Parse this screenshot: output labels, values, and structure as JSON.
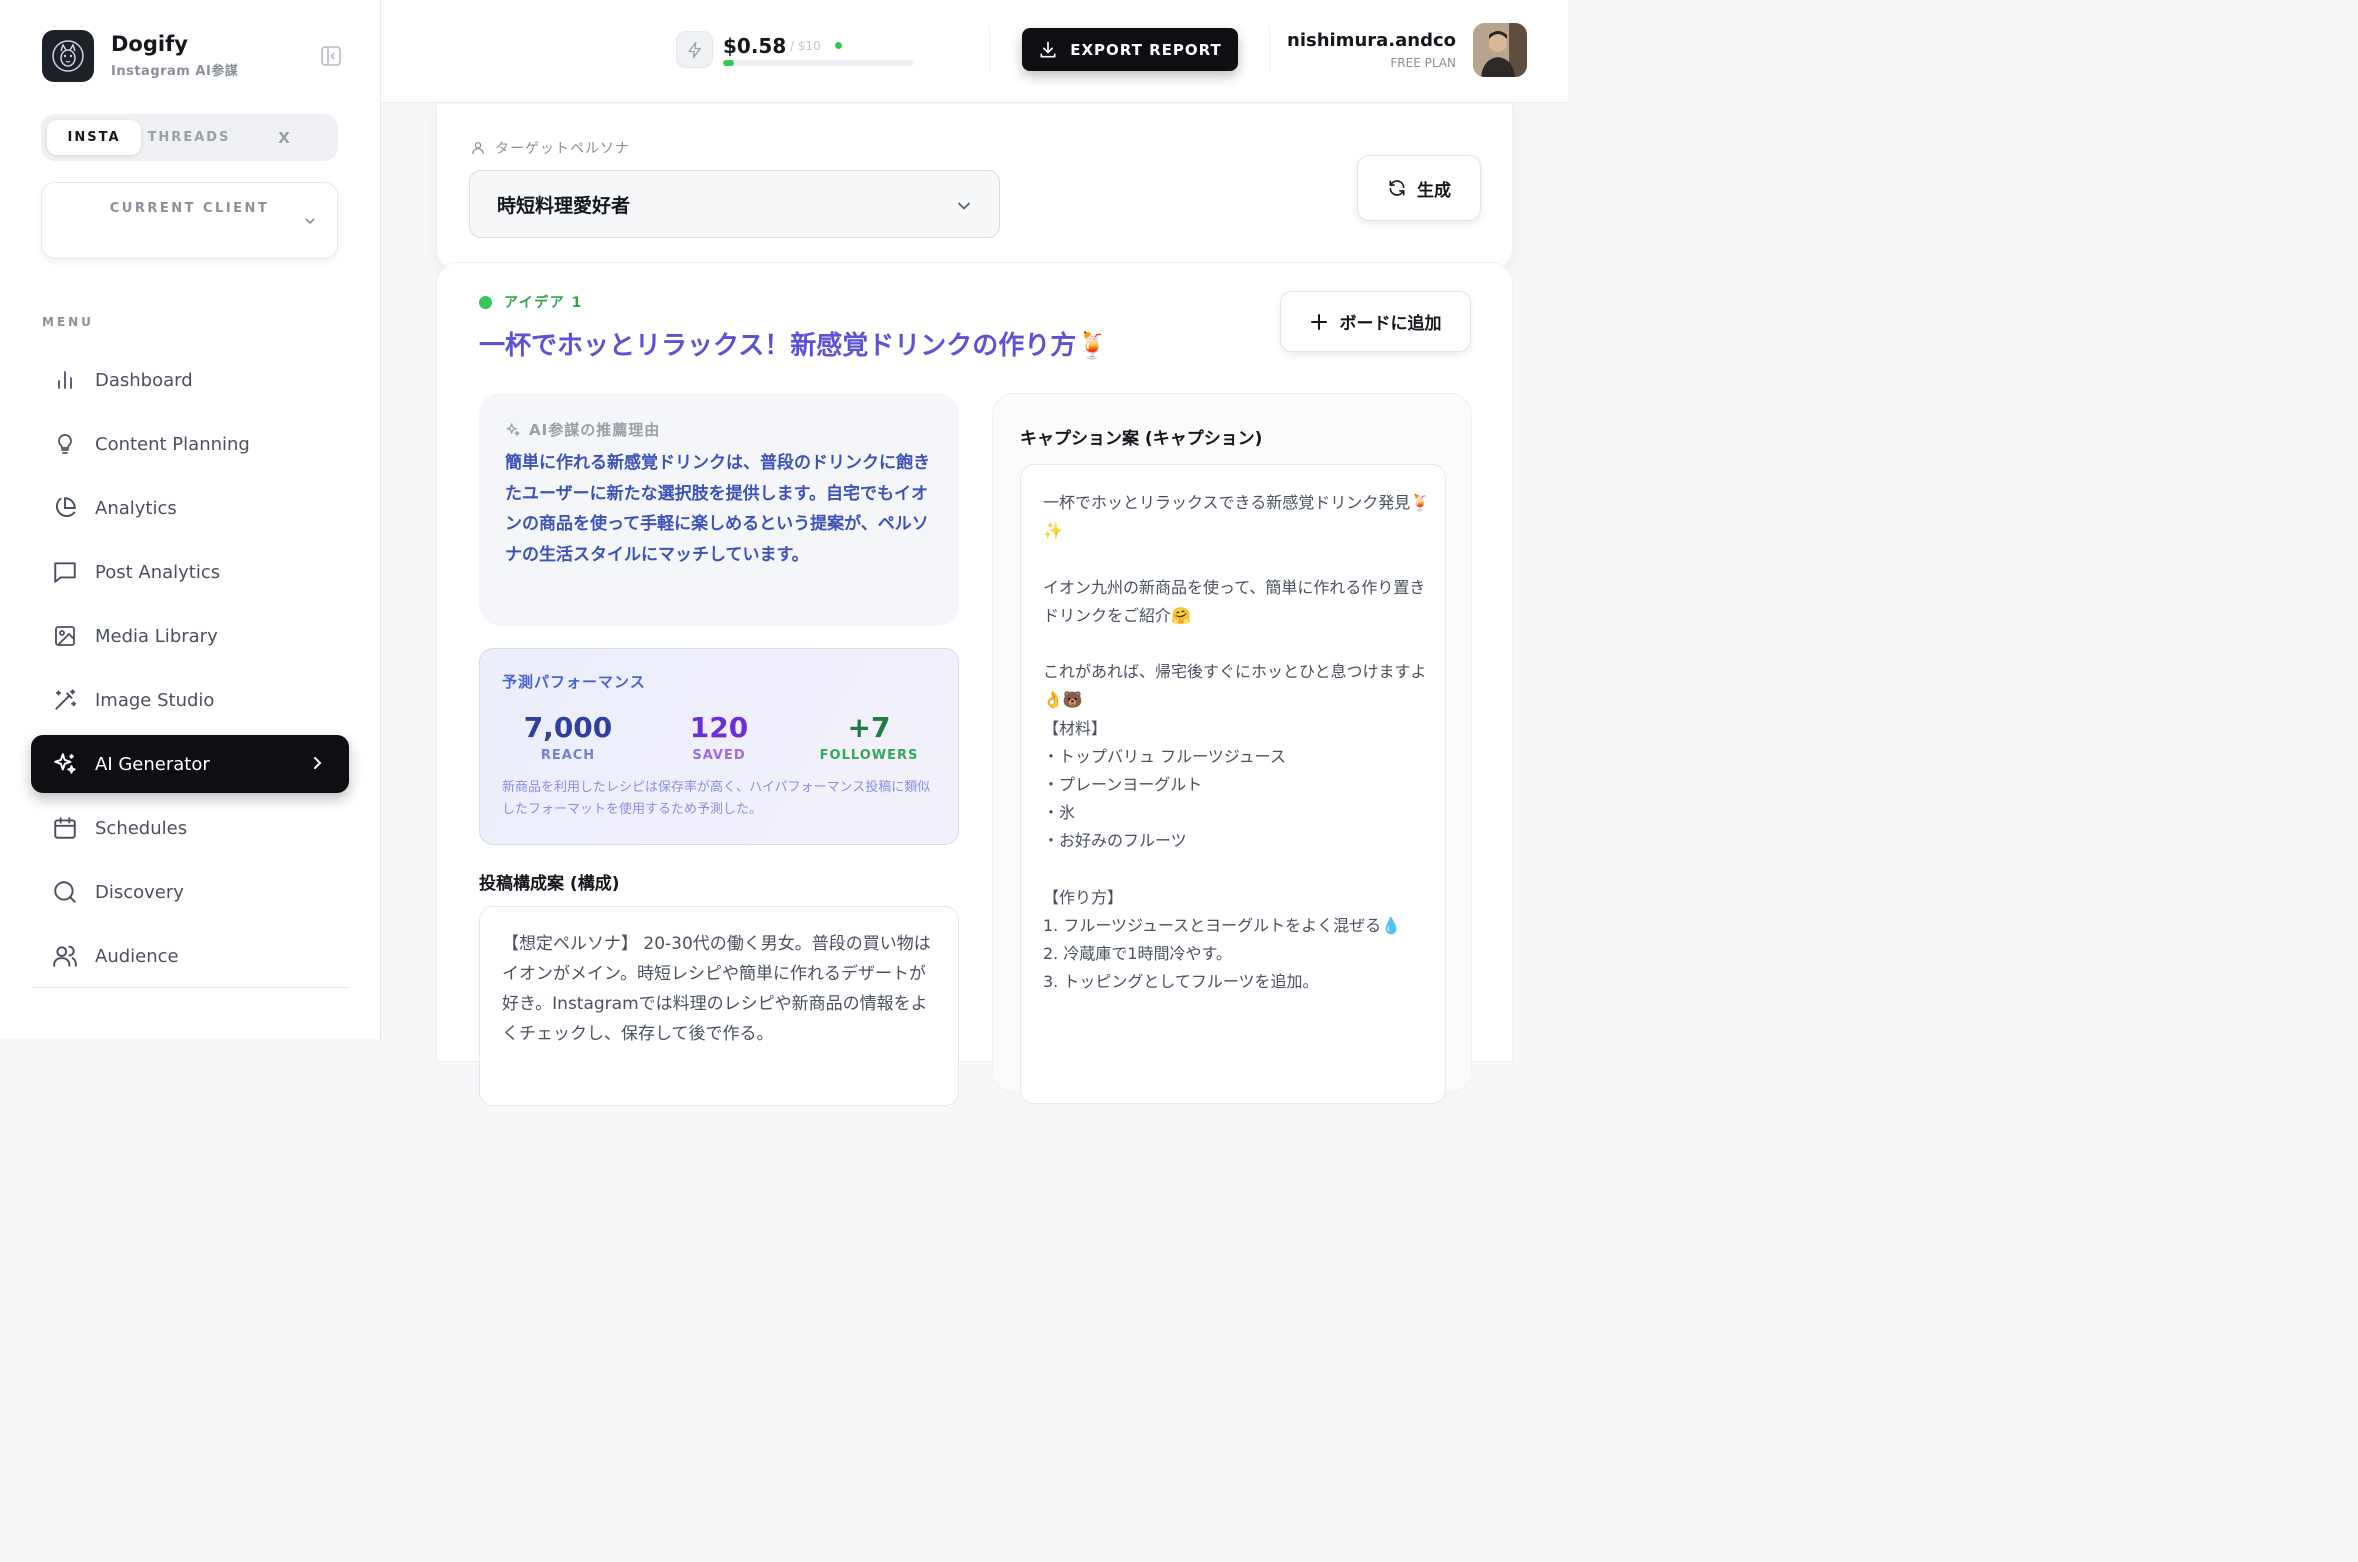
{
  "brand": {
    "name": "Dogify",
    "subtitle": "Instagram AI参謀"
  },
  "platform_tabs": [
    "INSTA",
    "THREADS",
    "X"
  ],
  "client": {
    "label": "CURRENT CLIENT"
  },
  "menu": {
    "label": "MENU",
    "items": [
      {
        "label": "Dashboard",
        "icon": "bar-chart-icon"
      },
      {
        "label": "Content Planning",
        "icon": "lightbulb-icon"
      },
      {
        "label": "Analytics",
        "icon": "pie-chart-icon"
      },
      {
        "label": "Post Analytics",
        "icon": "message-square-icon"
      },
      {
        "label": "Media Library",
        "icon": "image-icon"
      },
      {
        "label": "Image Studio",
        "icon": "wand-icon"
      },
      {
        "label": "AI Generator",
        "icon": "sparkles-icon",
        "active": true
      },
      {
        "label": "Schedules",
        "icon": "calendar-icon"
      },
      {
        "label": "Discovery",
        "icon": "search-icon"
      },
      {
        "label": "Audience",
        "icon": "users-icon"
      }
    ]
  },
  "header": {
    "cost_value": "$0.58",
    "cost_limit": "/ $10",
    "cost_usage_fraction": 0.058,
    "export_label": "EXPORT REPORT",
    "user_name": "nishimura.andco",
    "user_plan": "FREE PLAN"
  },
  "persona": {
    "label": "ターゲットペルソナ",
    "selected": "時短料理愛好者",
    "generate_label": "生成"
  },
  "idea": {
    "tag": "アイデア 1",
    "title": "一杯でホッとリラックス！新感覚ドリンクの作り方🍹",
    "add_board_label": "ボードに追加",
    "reason_label": "AI参謀の推薦理由",
    "reason_text": "簡単に作れる新感覚ドリンクは、普段のドリンクに飽きたユーザーに新たな選択肢を提供します。自宅でもイオンの商品を使って手軽に楽しめるという提案が、ペルソナの生活スタイルにマッチしています。",
    "performance": {
      "label": "予測パフォーマンス",
      "reach": {
        "value": "7,000",
        "label": "REACH"
      },
      "saved": {
        "value": "120",
        "label": "SAVED"
      },
      "followers": {
        "value": "+7",
        "label": "FOLLOWERS"
      },
      "note": "新商品を利用したレシピは保存率が高く、ハイパフォーマンス投稿に類似したフォーマットを使用するため予測した。"
    },
    "structure_title": "投稿構成案 (構成)",
    "structure_text": "【想定ペルソナ】 20-30代の働く男女。普段の買い物はイオンがメイン。時短レシピや簡単に作れるデザートが好き。Instagramでは料理のレシピや新商品の情報をよくチェックし、保存して後で作る。",
    "caption_title": "キャプション案 (キャプション)",
    "caption_text": "一杯でホッとリラックスできる新感覚ドリンク発見🍹✨\n\nイオン九州の新商品を使って、簡単に作れる作り置きドリンクをご紹介🤗\n\nこれがあれば、帰宅後すぐにホッとひと息つけますよ👌🐻\n【材料】\n・トップバリュ フルーツジュース\n・プレーンヨーグルト\n・氷\n・お好みのフルーツ\n\n【作り方】\n1. フルーツジュースとヨーグルトをよく混ぜる💧\n2. 冷蔵庫で1時間冷やす。\n3. トッピングとしてフルーツを追加。"
  },
  "colors": {
    "accent": "#5b52d6",
    "reason_text": "#3d53b8",
    "reach": "#2f3f9e",
    "saved": "#6b2fd6",
    "followers": "#1f7a45",
    "status_green": "#34c759"
  }
}
